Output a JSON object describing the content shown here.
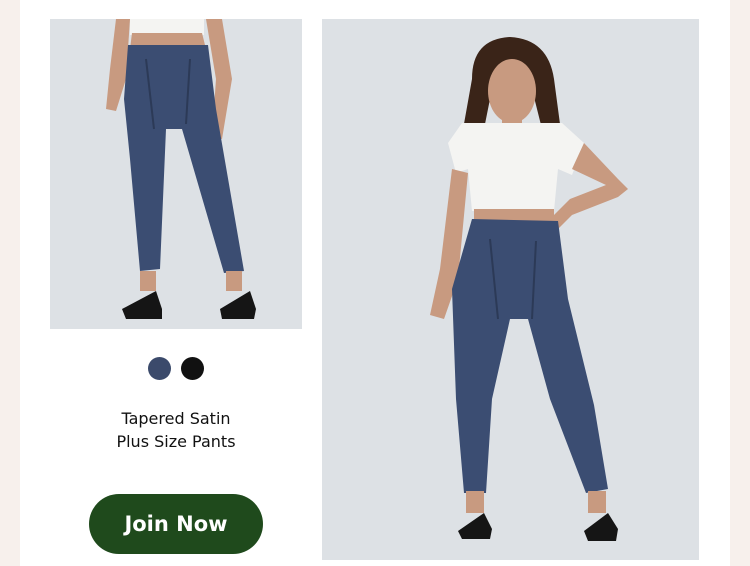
{
  "product": {
    "name_line1": "Tapered Satin",
    "name_line2": "Plus Size Pants",
    "color_options": [
      {
        "name": "navy",
        "color": "#3b4a6b"
      },
      {
        "name": "black",
        "color": "#111111"
      }
    ]
  },
  "cta": {
    "label": "Join Now",
    "color": "#1f4a1c"
  },
  "colors": {
    "page_background": "#f7f0ec",
    "card_background": "#ffffff",
    "photo_background": "#dde1e5",
    "pants": "#3b4d72",
    "top": "#f4f4f2"
  }
}
